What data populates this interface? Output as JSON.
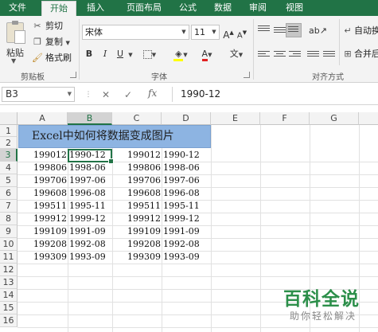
{
  "ribbon": {
    "tabs": [
      "文件",
      "开始",
      "插入",
      "页面布局",
      "公式",
      "数据",
      "审阅",
      "视图"
    ],
    "active_tab": "开始",
    "clipboard": {
      "paste": "粘贴",
      "cut": "剪切",
      "copy": "复制",
      "format_painter": "格式刷",
      "group_label": "剪贴板"
    },
    "font": {
      "font_name": "宋体",
      "font_size": "11",
      "grow": "A",
      "shrink": "A",
      "bold": "B",
      "italic": "I",
      "underline": "U",
      "font_color_glyph": "A",
      "wen_glyph": "文",
      "group_label": "字体"
    },
    "alignment": {
      "wrap_text": "自动换",
      "merge": "合并后",
      "group_label": "对齐方式"
    }
  },
  "formula_bar": {
    "name_box": "B3",
    "fx_label": "fx",
    "formula": "1990-12"
  },
  "sheet": {
    "columns": [
      "A",
      "B",
      "C",
      "D",
      "E",
      "F",
      "G"
    ],
    "selected_column": "B",
    "rows": [
      "1",
      "2",
      "3",
      "4",
      "5",
      "6",
      "7",
      "8",
      "9",
      "10",
      "11",
      "12",
      "13",
      "14",
      "15",
      "16"
    ],
    "selected_row": "3",
    "title": "Excel中如何将数据变成图片",
    "data": [
      [
        "199012",
        "1990-12",
        "199012",
        "1990-12"
      ],
      [
        "199806",
        "1998-06",
        "199806",
        "1998-06"
      ],
      [
        "199706",
        "1997-06",
        "199706",
        "1997-06"
      ],
      [
        "199608",
        "1996-08",
        "199608",
        "1996-08"
      ],
      [
        "199511",
        "1995-11",
        "199511",
        "1995-11"
      ],
      [
        "199912",
        "1999-12",
        "199912",
        "1999-12"
      ],
      [
        "199109",
        "1991-09",
        "199109",
        "1991-09"
      ],
      [
        "199208",
        "1992-08",
        "199208",
        "1992-08"
      ],
      [
        "199309",
        "1993-09",
        "199309",
        "1993-09"
      ]
    ]
  },
  "watermark": {
    "brand": "百科全说",
    "slogan": "助你轻松解决"
  }
}
